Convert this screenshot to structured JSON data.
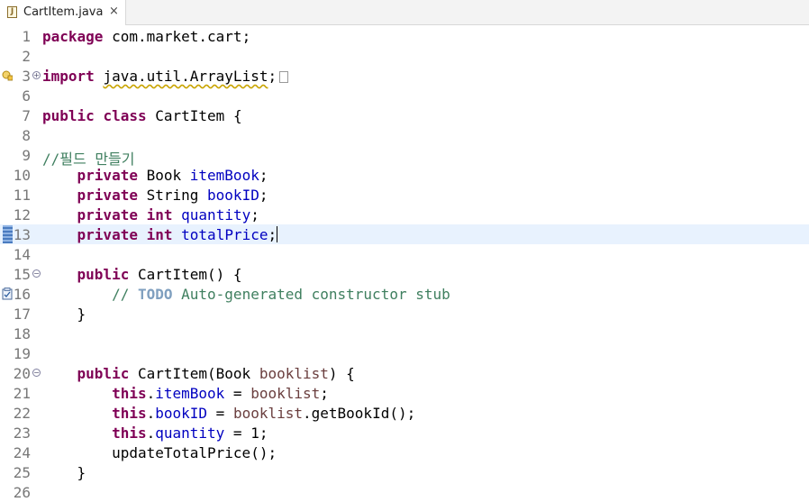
{
  "tab": {
    "title": "CartItem.java",
    "close": "×"
  },
  "editor": {
    "lines": [
      {
        "n": "1",
        "tokens": [
          [
            "kw",
            "package"
          ],
          [
            "p",
            " com.market.cart;"
          ]
        ]
      },
      {
        "n": "2",
        "tokens": []
      },
      {
        "n": "3",
        "tokens": [
          [
            "kw",
            "import"
          ],
          [
            "p",
            " "
          ],
          [
            "squig",
            "java.util.ArrayList"
          ],
          [
            "p",
            ";"
          ]
        ]
      },
      {
        "n": "6",
        "tokens": []
      },
      {
        "n": "7",
        "tokens": [
          [
            "kw",
            "public"
          ],
          [
            "p",
            " "
          ],
          [
            "kw",
            "class"
          ],
          [
            "p",
            " CartItem {"
          ]
        ]
      },
      {
        "n": "8",
        "tokens": []
      },
      {
        "n": "9",
        "tokens": [
          [
            "cmt",
            "//필드 만들기"
          ]
        ]
      },
      {
        "n": "10",
        "tokens": [
          [
            "p",
            "    "
          ],
          [
            "kw",
            "private"
          ],
          [
            "p",
            " Book "
          ],
          [
            "fld",
            "itemBook"
          ],
          [
            "p",
            ";"
          ]
        ]
      },
      {
        "n": "11",
        "tokens": [
          [
            "p",
            "    "
          ],
          [
            "kw",
            "private"
          ],
          [
            "p",
            " String "
          ],
          [
            "fld",
            "bookID"
          ],
          [
            "p",
            ";"
          ]
        ]
      },
      {
        "n": "12",
        "tokens": [
          [
            "p",
            "    "
          ],
          [
            "kw",
            "private"
          ],
          [
            "p",
            " "
          ],
          [
            "kw",
            "int"
          ],
          [
            "p",
            " "
          ],
          [
            "fld",
            "quantity"
          ],
          [
            "p",
            ";"
          ]
        ]
      },
      {
        "n": "13",
        "tokens": [
          [
            "p",
            "    "
          ],
          [
            "kw",
            "private"
          ],
          [
            "p",
            " "
          ],
          [
            "kw",
            "int"
          ],
          [
            "p",
            " "
          ],
          [
            "fld",
            "totalPrice"
          ],
          [
            "p",
            ";"
          ]
        ]
      },
      {
        "n": "14",
        "tokens": []
      },
      {
        "n": "15",
        "tokens": [
          [
            "p",
            "    "
          ],
          [
            "kw",
            "public"
          ],
          [
            "p",
            " CartItem() {"
          ]
        ]
      },
      {
        "n": "16",
        "tokens": [
          [
            "p",
            "        "
          ],
          [
            "cmt",
            "// "
          ],
          [
            "todo",
            "TODO"
          ],
          [
            "cmt",
            " Auto-generated constructor stub"
          ]
        ]
      },
      {
        "n": "17",
        "tokens": [
          [
            "p",
            "    }"
          ]
        ]
      },
      {
        "n": "18",
        "tokens": []
      },
      {
        "n": "19",
        "tokens": []
      },
      {
        "n": "20",
        "tokens": [
          [
            "p",
            "    "
          ],
          [
            "kw",
            "public"
          ],
          [
            "p",
            " CartItem(Book "
          ],
          [
            "prm",
            "booklist"
          ],
          [
            "p",
            ") {"
          ]
        ]
      },
      {
        "n": "21",
        "tokens": [
          [
            "p",
            "        "
          ],
          [
            "kw",
            "this"
          ],
          [
            "p",
            "."
          ],
          [
            "fld",
            "itemBook"
          ],
          [
            "p",
            " = "
          ],
          [
            "prm",
            "booklist"
          ],
          [
            "p",
            ";"
          ]
        ]
      },
      {
        "n": "22",
        "tokens": [
          [
            "p",
            "        "
          ],
          [
            "kw",
            "this"
          ],
          [
            "p",
            "."
          ],
          [
            "fld",
            "bookID"
          ],
          [
            "p",
            " = "
          ],
          [
            "prm",
            "booklist"
          ],
          [
            "p",
            ".getBookId();"
          ]
        ]
      },
      {
        "n": "23",
        "tokens": [
          [
            "p",
            "        "
          ],
          [
            "kw",
            "this"
          ],
          [
            "p",
            "."
          ],
          [
            "fld",
            "quantity"
          ],
          [
            "p",
            " = 1;"
          ]
        ]
      },
      {
        "n": "24",
        "tokens": [
          [
            "p",
            "        updateTotalPrice();"
          ]
        ]
      },
      {
        "n": "25",
        "tokens": [
          [
            "p",
            "    }"
          ]
        ]
      },
      {
        "n": "26",
        "tokens": []
      }
    ]
  },
  "colors": {
    "keyword": "#7f0055",
    "field": "#0000c0",
    "param": "#6a3e3e",
    "comment": "#3f7f5f",
    "todo": "#7f9fbf",
    "highlight": "#e8f2fe"
  },
  "icons": {
    "file": "java-file-icon",
    "close": "close-icon",
    "warning": "warning-icon",
    "bookmark": "bookmark-icon",
    "task": "task-icon",
    "fold": "fold-icon"
  }
}
